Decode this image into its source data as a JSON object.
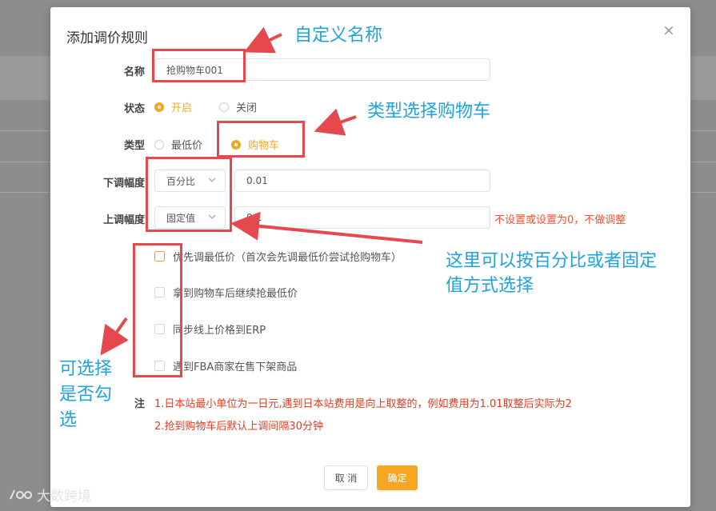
{
  "modal": {
    "title": "添加调价规则",
    "close_glyph": "×",
    "name": {
      "label": "名称",
      "value": "抢购物车001"
    },
    "status": {
      "label": "状态",
      "options": [
        {
          "label": "开启",
          "selected": true
        },
        {
          "label": "关闭",
          "selected": false
        }
      ]
    },
    "type": {
      "label": "类型",
      "options": [
        {
          "label": "最低价",
          "selected": false
        },
        {
          "label": "购物车",
          "selected": true
        }
      ]
    },
    "down": {
      "label": "下调幅度",
      "mode": "百分比",
      "value": "0.01"
    },
    "up": {
      "label": "上调幅度",
      "mode": "固定值",
      "value": "0.1",
      "hint": "不设置或设置为0，不做调整"
    },
    "checkboxes": [
      {
        "label": "优先调最低价（首次会先调最低价尝试抢购物车）",
        "checked": false
      },
      {
        "label": "拿到购物车后继续抢最低价",
        "checked": false
      },
      {
        "label": "同步线上价格到ERP",
        "checked": false
      },
      {
        "label": "遇到FBA商家在售下架商品",
        "checked": false
      }
    ],
    "notes": {
      "label": "注",
      "line1": "1.日本站最小单位为一日元,遇到日本站费用是向上取整的，例如费用为1.01取整后实际为2",
      "line2": "2.抢到购物车后默认上调间隔30分钟"
    },
    "buttons": {
      "cancel": "取 消",
      "confirm": "确定"
    }
  },
  "annotations": {
    "custom_name": "自定义名称",
    "type_cart": "类型选择购物车",
    "percent_or_fixed_line1": "这里可以按百分比或者固定",
    "percent_or_fixed_line2": "值方式选择",
    "optional_line1": "可选择",
    "optional_line2": "是否勾",
    "optional_line3": "选"
  },
  "watermark": {
    "text": "大数跨境"
  },
  "colors": {
    "accent": "#f5a623",
    "annotation": "#1fa3e0",
    "highlight": "#e5484d",
    "note": "#e63a1e"
  }
}
